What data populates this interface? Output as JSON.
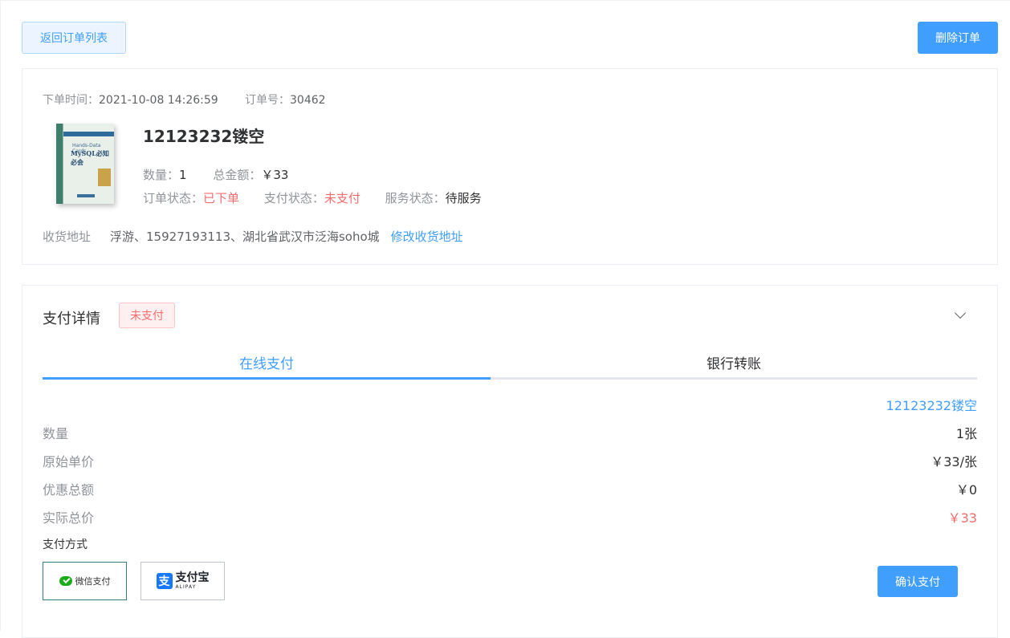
{
  "toolbar": {
    "back_label": "返回订单列表",
    "delete_label": "删除订单"
  },
  "order": {
    "time_label": "下单时间：",
    "time_value": "2021-10-08 14:26:59",
    "no_label": "订单号：",
    "no_value": "30462",
    "cover": {
      "line1": "Hands-Data Cards",
      "line2": "MySQL必知必会"
    },
    "product_title": "12123232镂空",
    "qty_label": "数量：",
    "qty_value": "1",
    "total_label": "总金额：",
    "total_value": "￥33",
    "status_label": "订单状态：",
    "status_value": "已下单",
    "pay_status_label": "支付状态：",
    "pay_status_value": "未支付",
    "service_status_label": "服务状态：",
    "service_status_value": "待服务",
    "address_label": "收货地址",
    "address_value": "浮游、15927193113、湖北省武汉市泛海soho城",
    "edit_address_label": "修改收货地址"
  },
  "payment": {
    "title": "支付详情",
    "status_tag": "未支付",
    "tabs": [
      {
        "label": "在线支付",
        "active": true
      },
      {
        "label": "银行转账",
        "active": false
      }
    ],
    "product_name": "12123232镂空",
    "rows": [
      {
        "key": "数量",
        "value": "1张"
      },
      {
        "key": "原始单价",
        "value": "￥33/张"
      },
      {
        "key": "优惠总额",
        "value": "￥0"
      },
      {
        "key": "实际总价",
        "value": "￥33"
      }
    ],
    "method_label": "支付方式",
    "methods": {
      "wechat": "微信支付",
      "alipay_cn": "支付宝",
      "alipay_en": "ALIPAY",
      "alipay_glyph": "支"
    },
    "confirm_label": "确认支付"
  },
  "colors": {
    "primary": "#409eff",
    "danger": "#f56c6c",
    "wechat": "#1aad19",
    "alipay": "#1677ff"
  }
}
